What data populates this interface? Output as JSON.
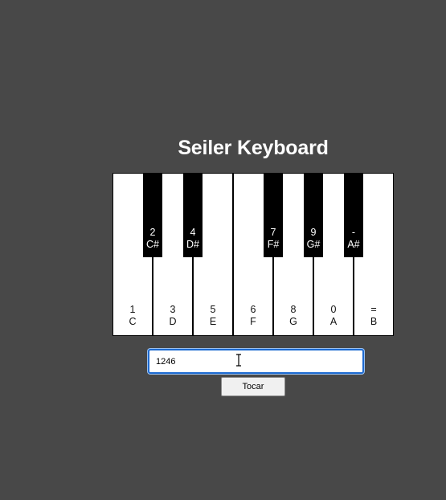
{
  "app": {
    "title": "Seiler Keyboard"
  },
  "keyboard": {
    "white_keys": [
      {
        "shortcut": "1",
        "note": "C"
      },
      {
        "shortcut": "3",
        "note": "D"
      },
      {
        "shortcut": "5",
        "note": "E"
      },
      {
        "shortcut": "6",
        "note": "F"
      },
      {
        "shortcut": "8",
        "note": "G"
      },
      {
        "shortcut": "0",
        "note": "A"
      },
      {
        "shortcut": "=",
        "note": "B"
      }
    ],
    "black_keys": [
      {
        "shortcut": "2",
        "note": "C#"
      },
      {
        "shortcut": "4",
        "note": "D#"
      },
      {
        "shortcut": "7",
        "note": "F#"
      },
      {
        "shortcut": "9",
        "note": "G#"
      },
      {
        "shortcut": "-",
        "note": "A#"
      }
    ]
  },
  "input": {
    "value": "1246",
    "placeholder": ""
  },
  "play_button": {
    "label": "Tocar"
  },
  "colors": {
    "background": "#484848",
    "input_focus": "#1d6ad1",
    "white_key": "#ffffff",
    "black_key": "#000000"
  }
}
